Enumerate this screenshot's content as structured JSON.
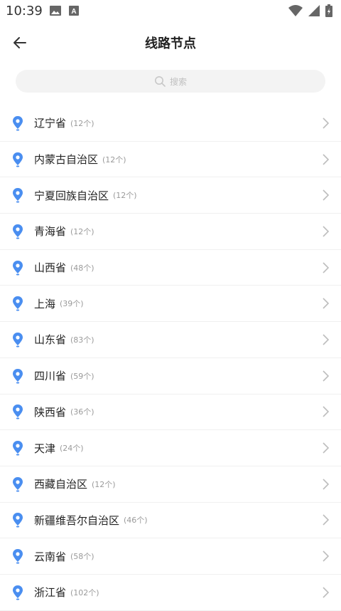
{
  "status": {
    "time": "10:39"
  },
  "header": {
    "title": "线路节点"
  },
  "search": {
    "placeholder": "搜索"
  },
  "regions": [
    {
      "name": "辽宁省",
      "count": "(12个)"
    },
    {
      "name": "内蒙古自治区",
      "count": "(12个)"
    },
    {
      "name": "宁夏回族自治区",
      "count": "(12个)"
    },
    {
      "name": "青海省",
      "count": "(12个)"
    },
    {
      "name": "山西省",
      "count": "(48个)"
    },
    {
      "name": "上海",
      "count": "(39个)"
    },
    {
      "name": "山东省",
      "count": "(83个)"
    },
    {
      "name": "四川省",
      "count": "(59个)"
    },
    {
      "name": "陕西省",
      "count": "(36个)"
    },
    {
      "name": "天津",
      "count": "(24个)"
    },
    {
      "name": "西藏自治区",
      "count": "(12个)"
    },
    {
      "name": "新疆维吾尔自治区",
      "count": "(46个)"
    },
    {
      "name": "云南省",
      "count": "(58个)"
    },
    {
      "name": "浙江省",
      "count": "(102个)"
    }
  ],
  "colors": {
    "accent": "#4a8ef0"
  }
}
